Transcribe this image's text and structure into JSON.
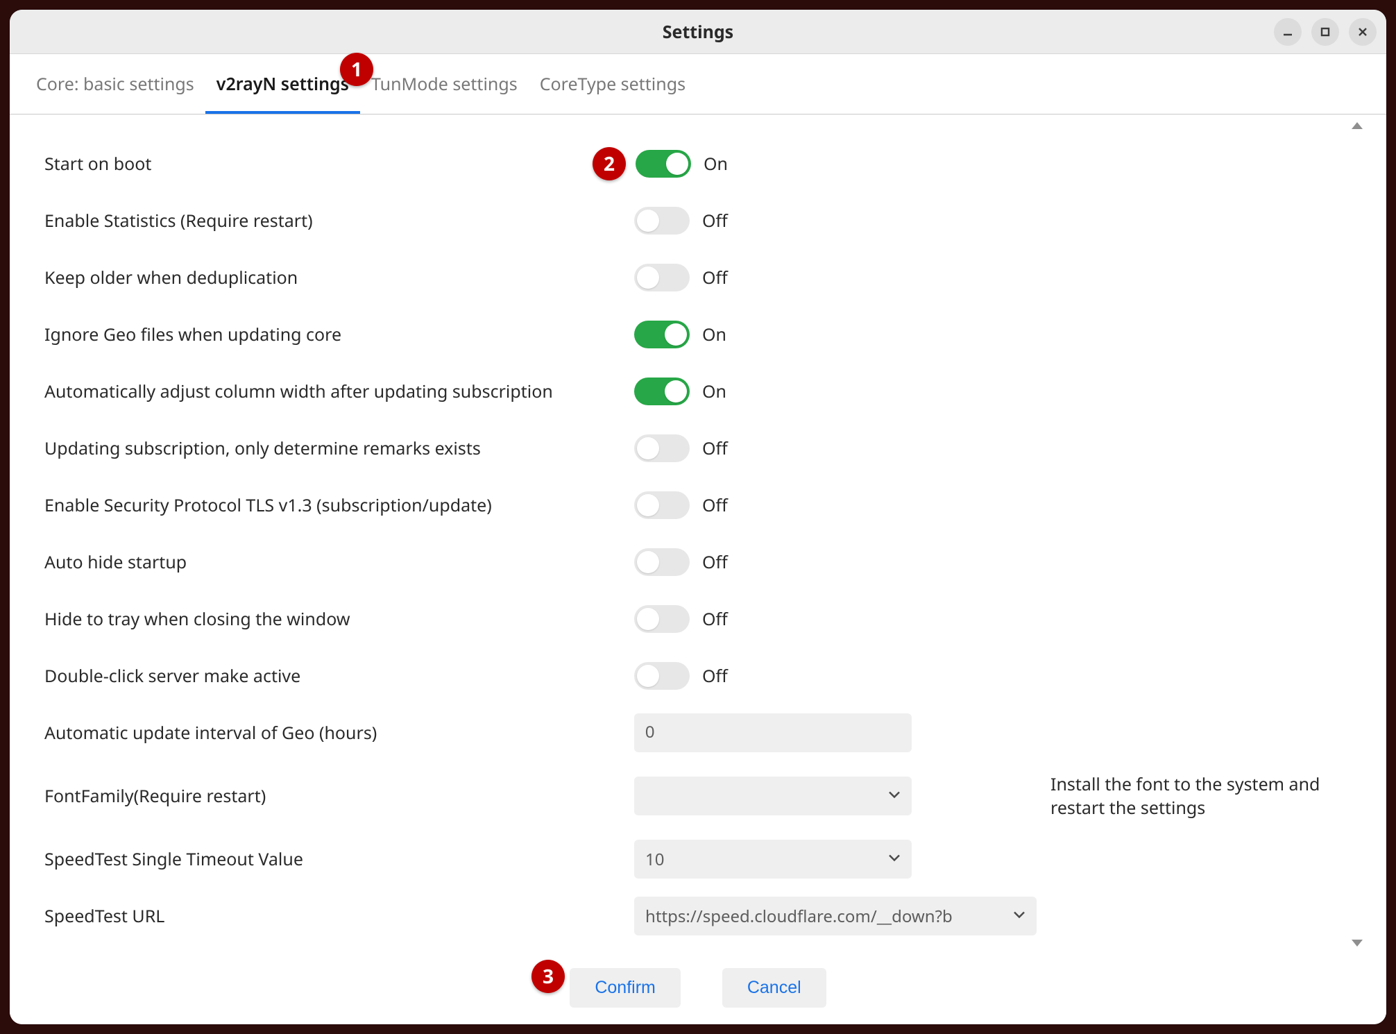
{
  "window": {
    "title": "Settings"
  },
  "tabs": [
    {
      "label": "Core: basic settings",
      "active": false
    },
    {
      "label": "v2rayN settings",
      "active": true
    },
    {
      "label": "TunMode settings",
      "active": false
    },
    {
      "label": "CoreType settings",
      "active": false
    }
  ],
  "toggles": {
    "on_text": "On",
    "off_text": "Off"
  },
  "rows": {
    "start_on_boot": {
      "label": "Start on boot",
      "on": true
    },
    "enable_stats": {
      "label": "Enable Statistics (Require restart)",
      "on": false
    },
    "keep_older": {
      "label": "Keep older when deduplication",
      "on": false
    },
    "ignore_geo": {
      "label": "Ignore Geo files when updating core",
      "on": true
    },
    "auto_col_width": {
      "label": "Automatically adjust column width after updating subscription",
      "on": true
    },
    "update_sub_remarks": {
      "label": "Updating subscription, only determine remarks exists",
      "on": false
    },
    "tls13": {
      "label": "Enable Security Protocol TLS v1.3 (subscription/update)",
      "on": false
    },
    "auto_hide": {
      "label": "Auto hide startup",
      "on": false
    },
    "hide_to_tray": {
      "label": "Hide to tray when closing the window",
      "on": false
    },
    "dbl_click": {
      "label": "Double-click server make active",
      "on": false
    },
    "geo_interval": {
      "label": "Automatic update interval of Geo (hours)",
      "value": "0"
    },
    "font_family": {
      "label": "FontFamily(Require restart)",
      "value": "",
      "note": "Install the font to the system and restart the settings"
    },
    "speedtest_timeout": {
      "label": "SpeedTest Single Timeout Value",
      "value": "10"
    },
    "speedtest_url": {
      "label": "SpeedTest URL",
      "value": "https://speed.cloudflare.com/__down?b"
    }
  },
  "buttons": {
    "confirm": "Confirm",
    "cancel": "Cancel"
  },
  "annotations": {
    "a1": "1",
    "a2": "2",
    "a3": "3"
  }
}
